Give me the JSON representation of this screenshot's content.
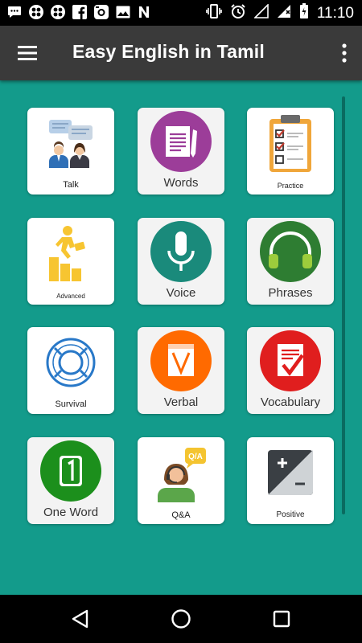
{
  "status_bar": {
    "time": "11:10",
    "left_icons": [
      "messenger-icon",
      "app-grid-icon",
      "app-grid-icon",
      "facebook-icon",
      "camera-icon",
      "image-icon",
      "n-icon"
    ],
    "right_icons": [
      "vibrate-icon",
      "alarm-icon",
      "signal-icon",
      "no-sim-icon",
      "battery-icon"
    ]
  },
  "app_bar": {
    "title": "Easy English in Tamil",
    "menu_icon": "hamburger-menu-icon",
    "more_icon": "more-vertical-icon"
  },
  "colors": {
    "background": "#139b8b",
    "app_bar": "#3a3a3a",
    "purple": "#9c3d99",
    "teal": "#1a8a7b",
    "green": "#2e7d32",
    "orange": "#ff6a00",
    "red": "#e01e1e"
  },
  "tiles": [
    {
      "label": "Talk",
      "icon": "conversation-icon"
    },
    {
      "label": "Words",
      "icon": "document-pen-icon"
    },
    {
      "label": "Practice",
      "icon": "clipboard-checklist-icon"
    },
    {
      "label": "Advanced",
      "icon": "climbing-stairs-icon"
    },
    {
      "label": "Voice",
      "icon": "microphone-icon"
    },
    {
      "label": "Phrases",
      "icon": "headphones-icon"
    },
    {
      "label": "Survival",
      "icon": "lifebuoy-icon"
    },
    {
      "label": "Verbal",
      "icon": "letter-v-icon"
    },
    {
      "label": "Vocabulary",
      "icon": "checklist-red-icon"
    },
    {
      "label": "One Word",
      "icon": "number-one-icon"
    },
    {
      "label": "Q&A",
      "icon": "support-agent-icon"
    },
    {
      "label": "Positive",
      "icon": "plus-minus-icon"
    }
  ],
  "nav_bar": {
    "back_icon": "back-triangle-icon",
    "home_icon": "home-circle-icon",
    "recents_icon": "recents-square-icon"
  }
}
